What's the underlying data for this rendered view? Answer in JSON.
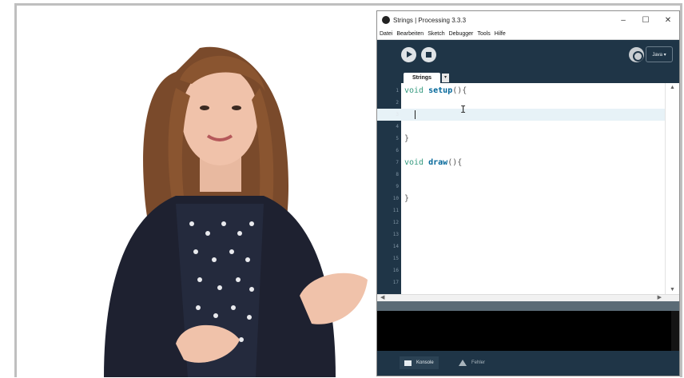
{
  "window": {
    "title": "Strings | Processing 3.3.3",
    "controls": {
      "minimize": "–",
      "maximize": "☐",
      "close": "✕"
    }
  },
  "menu": [
    "Datei",
    "Bearbeiten",
    "Sketch",
    "Debugger",
    "Tools",
    "Hilfe"
  ],
  "toolbar": {
    "mode_label": "Java ▾"
  },
  "tabs": [
    {
      "label": "Strings"
    }
  ],
  "tab_menu_arrow": "▾",
  "editor": {
    "lines": [
      {
        "num": "1",
        "tokens": [
          {
            "t": "void ",
            "c": "kw"
          },
          {
            "t": "setup",
            "c": "fn"
          },
          {
            "t": "(){",
            "c": "p"
          }
        ]
      },
      {
        "num": "2",
        "tokens": []
      },
      {
        "num": "3",
        "tokens": [],
        "current": true
      },
      {
        "num": "4",
        "tokens": []
      },
      {
        "num": "5",
        "tokens": [
          {
            "t": "}",
            "c": "p"
          }
        ]
      },
      {
        "num": "6",
        "tokens": []
      },
      {
        "num": "7",
        "tokens": [
          {
            "t": "void ",
            "c": "kw"
          },
          {
            "t": "draw",
            "c": "fn"
          },
          {
            "t": "(){",
            "c": "p"
          }
        ]
      },
      {
        "num": "8",
        "tokens": []
      },
      {
        "num": "9",
        "tokens": []
      },
      {
        "num": "10",
        "tokens": [
          {
            "t": "}",
            "c": "p"
          }
        ]
      },
      {
        "num": "11",
        "tokens": []
      },
      {
        "num": "12",
        "tokens": []
      },
      {
        "num": "13",
        "tokens": []
      },
      {
        "num": "14",
        "tokens": []
      },
      {
        "num": "15",
        "tokens": []
      },
      {
        "num": "16",
        "tokens": []
      },
      {
        "num": "17",
        "tokens": []
      }
    ]
  },
  "status": {
    "console_label": "Konsole",
    "errors_label": "Fehler"
  },
  "colors": {
    "ide_dark": "#1f3547",
    "keyword": "#33997e",
    "function": "#006699",
    "current_line": "#e7f2f7"
  }
}
